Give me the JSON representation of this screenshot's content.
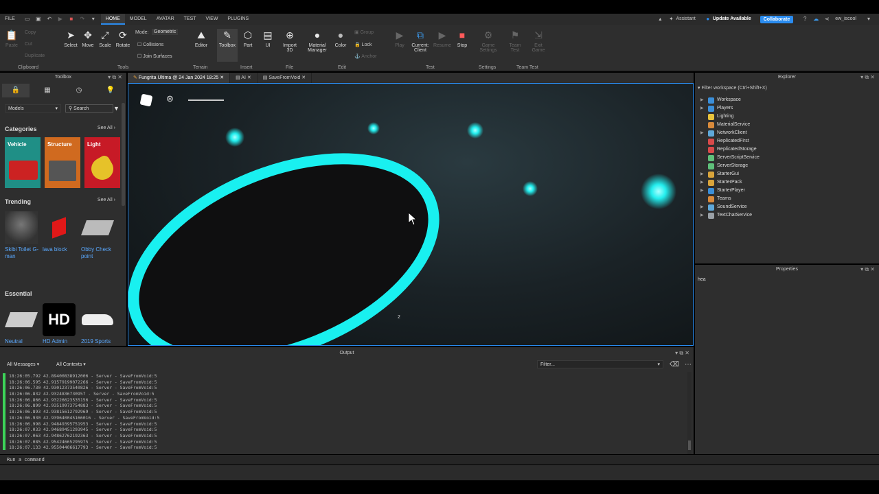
{
  "menu": {
    "file": "FILE",
    "tabs": [
      "HOME",
      "MODEL",
      "AVATAR",
      "TEST",
      "VIEW",
      "PLUGINS"
    ],
    "assistant": "Assistant",
    "update": "Update Available",
    "collaborate": "Collaborate",
    "username": "ew_iscool"
  },
  "ribbon": {
    "clipboard": {
      "paste": "Paste",
      "copy": "Copy",
      "cut": "Cut",
      "duplicate": "Duplicate",
      "label": "Clipboard"
    },
    "tools": {
      "select": "Select",
      "move": "Move",
      "scale": "Scale",
      "rotate": "Rotate",
      "label": "Tools",
      "mode_label": "Mode:",
      "mode_value": "Geometric",
      "collisions": "Collisions",
      "join": "Join Surfaces"
    },
    "terrain": {
      "editor": "Editor",
      "label": "Terrain"
    },
    "insert": {
      "toolbox": "Toolbox",
      "part": "Part",
      "ui": "UI",
      "label": "Insert"
    },
    "file": {
      "import": "Import\n3D",
      "label": "File"
    },
    "edit": {
      "material": "Material\nManager",
      "color": "Color",
      "group": "Group",
      "lock": "Lock",
      "anchor": "Anchor",
      "label": "Edit"
    },
    "test": {
      "play": "Play",
      "current": "Current:\nClient",
      "resume": "Resume",
      "stop": "Stop",
      "label": "Test"
    },
    "settings": {
      "game": "Game\nSettings",
      "label": "Settings"
    },
    "teamtest": {
      "team": "Team\nTest",
      "exit": "Exit\nGame",
      "label": "Team Test"
    }
  },
  "toolbox": {
    "title": "Toolbox",
    "category_select": "Models",
    "search_placeholder": "Search",
    "categories_title": "Categories",
    "see_all": "See All",
    "categories": [
      {
        "label": "Vehicle",
        "color": "#1f8f86"
      },
      {
        "label": "Structure",
        "color": "#d06a1f"
      },
      {
        "label": "Light",
        "color": "#c71a26"
      }
    ],
    "trending_title": "Trending",
    "trending": [
      "Skibi Toilet G-man",
      "lava block",
      "Obby Check point"
    ],
    "essential_title": "Essential",
    "essential": [
      "Neutral",
      "HD Admin",
      "2019 Sports"
    ]
  },
  "viewport": {
    "tabs": [
      "Fungrita Ultima @ 24 Jan 2024 18:25",
      "AI",
      "SaveFromVoid"
    ],
    "marker": "2"
  },
  "explorer": {
    "title": "Explorer",
    "filter": "Filter workspace (Ctrl+Shift+X)",
    "items": [
      {
        "label": "Workspace",
        "expandable": true,
        "color": "#3b8fd9"
      },
      {
        "label": "Players",
        "expandable": true,
        "color": "#3b8fd9"
      },
      {
        "label": "Lighting",
        "expandable": false,
        "color": "#e8c33c"
      },
      {
        "label": "MaterialService",
        "expandable": false,
        "color": "#d98a3b"
      },
      {
        "label": "NetworkClient",
        "expandable": true,
        "color": "#5fa8d9"
      },
      {
        "label": "ReplicatedFirst",
        "expandable": false,
        "color": "#d94a4a"
      },
      {
        "label": "ReplicatedStorage",
        "expandable": false,
        "color": "#d94a4a"
      },
      {
        "label": "ServerScriptService",
        "expandable": false,
        "color": "#5fc07a"
      },
      {
        "label": "ServerStorage",
        "expandable": false,
        "color": "#5fc07a"
      },
      {
        "label": "StarterGui",
        "expandable": true,
        "color": "#d9a43b"
      },
      {
        "label": "StarterPack",
        "expandable": true,
        "color": "#d9a43b"
      },
      {
        "label": "StarterPlayer",
        "expandable": true,
        "color": "#3b8fd9"
      },
      {
        "label": "Teams",
        "expandable": false,
        "color": "#d98a3b"
      },
      {
        "label": "SoundService",
        "expandable": true,
        "color": "#5fa8d9"
      },
      {
        "label": "TextChatService",
        "expandable": true,
        "color": "#9aa0a6"
      }
    ]
  },
  "properties": {
    "title": "Properties",
    "filter_value": "hea"
  },
  "output": {
    "title": "Output",
    "filter_messages": "All Messages",
    "filter_contexts": "All Contexts",
    "filter_placeholder": "Filter...",
    "lines": [
      "18:26:05.792  42.89400838912006  -  Server - SaveFromVoid:5",
      "18:26:06.595  42.91579199072266  -  Server - SaveFromVoid:5",
      "18:26:06.730  42.93012373540826  -  Server - SaveFromVoid:5",
      "18:26:06.832  42.9324836730957  -  Server - SaveFromVoid:5",
      "18:26:06.866  42.93226623535156  -  Server - SaveFromVoid:5",
      "18:26:06.899  42.93519973754883  -  Server - SaveFromVoid:5",
      "18:26:06.893  42.93815612792969  -  Server - SaveFromVoid:5",
      "18:26:06.930  42.939640045166016  -  Server - SaveFromVoid:5",
      "18:26:06.998  42.94849395751953  -  Server - SaveFromVoid:5",
      "18:26:07.033  42.94689451293945  -  Server - SaveFromVoid:5",
      "18:26:07.063  42.94862762192363  -  Server - SaveFromVoid:5",
      "18:26:07.085  42.95424665295975  -  Server - SaveFromVoid:5",
      "18:26:07.133  42.95504406617793  -  Server - SaveFromVoid:5"
    ]
  },
  "command": {
    "placeholder": "Run a command"
  }
}
